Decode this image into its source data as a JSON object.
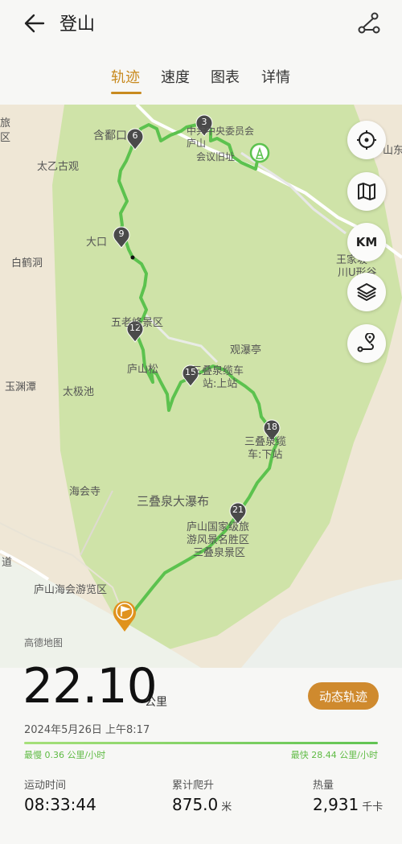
{
  "header": {
    "title": "登山"
  },
  "tabs": [
    {
      "label": "轨迹",
      "active": true
    },
    {
      "label": "速度"
    },
    {
      "label": "图表"
    },
    {
      "label": "详情"
    }
  ],
  "map": {
    "labels": {
      "l1": "旅",
      "l2": "区",
      "l3": "含鄱口",
      "l4": "太乙古观",
      "l5": "大口",
      "l6": "白鹤洞",
      "l7": "五老峰景区",
      "l8": "庐山松",
      "l9": "玉渊潭",
      "l10": "太极池",
      "l11": "观瀑亭",
      "l12": "三叠泉缆车",
      "l13": "站:上站",
      "l14": "三叠泉缆",
      "l15": "车:下站",
      "l16": "海会寺",
      "l17": "三叠泉大瀑布",
      "l18": "庐山国家级旅",
      "l19": "游风景名胜区",
      "l20": "三叠泉景区",
      "l21": "庐山海会游览区",
      "l22": "道",
      "l23": "中共中央委员会庐山",
      "l24": "会议旧址",
      "l25": "山东",
      "l26": "王家坡",
      "l27": "川U形谷"
    },
    "markers": [
      "3",
      "6",
      "9",
      "12",
      "15",
      "18",
      "21"
    ],
    "controls": {
      "km": "KM"
    },
    "icons": [
      "locate-icon",
      "map-icon",
      "layers-icon",
      "route-pin-icon"
    ]
  },
  "provider": "高德地图",
  "summary": {
    "distance": "22.10",
    "distance_unit": "公里",
    "replay_button": "动态轨迹",
    "datetime": "2024年5月26日 上午8:17",
    "slowest": "最慢 0.36 公里/小时",
    "fastest": "最快 28.44 公里/小时"
  },
  "stats": [
    {
      "label": "运动时间",
      "value": "08:33:44",
      "unit": ""
    },
    {
      "label": "累计爬升",
      "value": "875.0",
      "unit": "米"
    },
    {
      "label": "热量",
      "value": "2,931",
      "unit": "千卡"
    }
  ],
  "colors": {
    "accent": "#c88a1f",
    "track": "#5cc24e",
    "park": "#cfe3a8",
    "button": "#cf8a2e"
  }
}
